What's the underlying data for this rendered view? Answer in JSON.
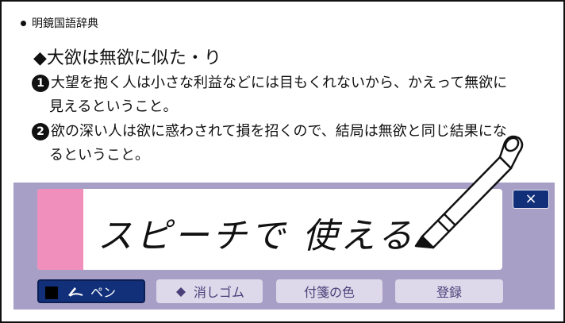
{
  "dictionary": {
    "name": "明鏡国語辞典"
  },
  "entry": {
    "headword": "◆大欲は無欲に似た・り",
    "senses": [
      {
        "num": "1",
        "line1": "大望を抱く人は小さな利益などには目もくれないから、かえって無欲に",
        "line2": "見えるということ。"
      },
      {
        "num": "2",
        "line1": "欲の深い人は欲に惑わされて損を招くので、結局は無欲と同じ結果にな",
        "line2": "るということ。"
      }
    ]
  },
  "memo": {
    "handwriting": "スピーチで 使える",
    "note_color": "#f08fbb",
    "close_label": "×"
  },
  "toolbar": {
    "pen_label": "ペン",
    "eraser_label": "消しゴム",
    "sticky_color_label": "付箋の色",
    "register_label": "登録"
  },
  "colors": {
    "panel": "#a89fc6",
    "accent": "#12307a",
    "button": "#ddd8ea"
  }
}
